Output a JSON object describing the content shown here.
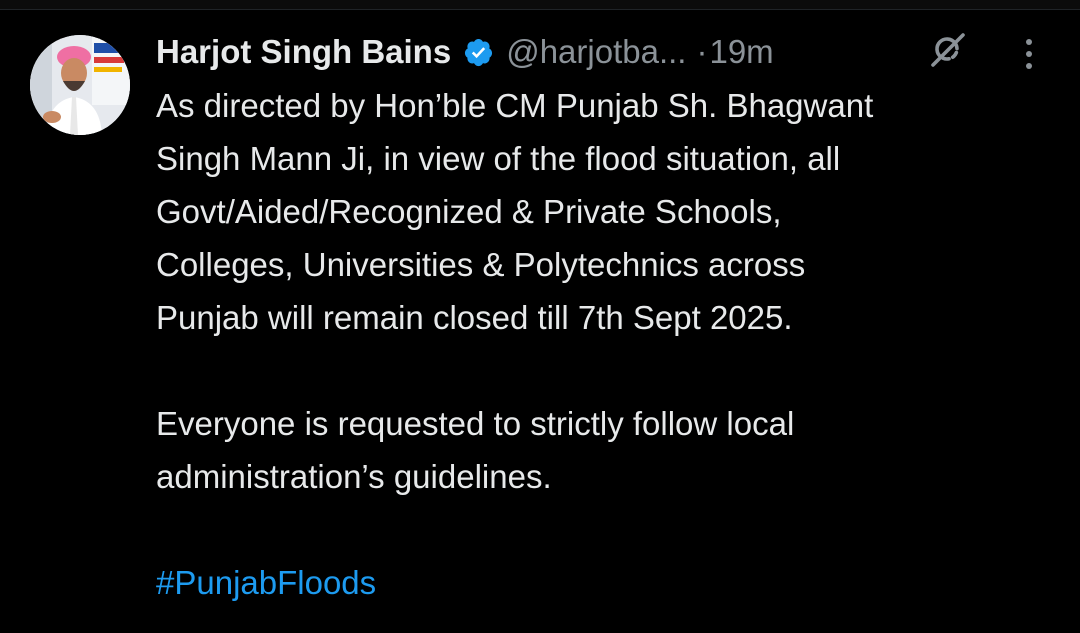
{
  "author": {
    "display_name": "Harjot Singh Bains",
    "handle": "@harjotba...",
    "separator": "·",
    "timestamp": "19m"
  },
  "icons": {
    "avatar": "profile-photo",
    "verified": "verified-badge-icon",
    "grok": "grok-icon",
    "more": "more-vertical-icon"
  },
  "colors": {
    "background": "#000000",
    "text": "#e7e9ea",
    "secondary": "#8b9298",
    "link": "#1d9bf0",
    "verified": "#1d9bf0"
  },
  "tweet": {
    "paragraph1": [
      "As directed by Hon’ble CM Punjab Sh. Bhagwant",
      "Singh Mann Ji, in view of the flood situation, all",
      "Govt/Aided/Recognized & Private Schools,",
      "Colleges, Universities & Polytechnics across",
      "Punjab will remain closed till 7th Sept 2025."
    ],
    "paragraph2": [
      "Everyone is requested to strictly follow local",
      "administration’s guidelines."
    ],
    "hashtag": "#PunjabFloods"
  }
}
